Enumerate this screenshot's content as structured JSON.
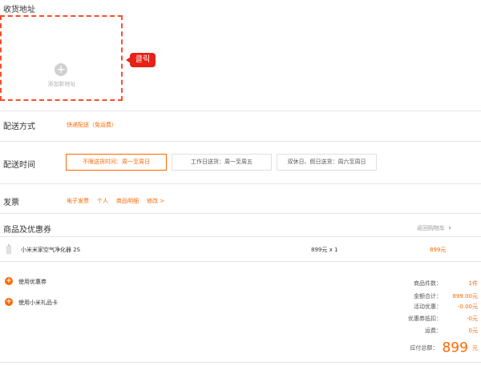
{
  "address": {
    "section_title": "收货地址",
    "add_label": "添加新地址",
    "click_tag": "클릭"
  },
  "delivery": {
    "section_title": "配送方式",
    "value": "快递配送（免运费）"
  },
  "delivery_time": {
    "section_title": "配送时间",
    "options": [
      {
        "label": "不限送货时间：周一至周日",
        "selected": true
      },
      {
        "label": "工作日送货：周一至周五",
        "selected": false
      },
      {
        "label": "双休日、假日送货：周六至周日",
        "selected": false
      }
    ]
  },
  "invoice": {
    "section_title": "发票",
    "type": "电子发票",
    "holder": "个人",
    "content": "商品明细",
    "edit": "修改 >"
  },
  "goods": {
    "section_title": "商品及优惠券",
    "back_to_cart": "返回购物车",
    "items": [
      {
        "name": "小米米家空气净化器 2S",
        "price_qty": "899元 x 1",
        "total": "899元"
      }
    ]
  },
  "coupons": {
    "use_coupon": "使用优惠券",
    "use_gift_card": "使用小米礼品卡"
  },
  "summary": {
    "rows": [
      {
        "label": "商品件数：",
        "value": "1件"
      },
      {
        "label": "金额合计：",
        "value": "899.00元"
      },
      {
        "label": "活动优惠：",
        "value": "-0.00元"
      },
      {
        "label": "优惠券抵扣：",
        "value": "-0元"
      },
      {
        "label": "运费：",
        "value": "0元"
      }
    ],
    "total_label": "应付总额：",
    "total_amount": "899",
    "total_unit": "元"
  },
  "colors": {
    "accent": "#ff6700",
    "dashed_border": "#ff4c2c",
    "tag": "#e62117"
  }
}
